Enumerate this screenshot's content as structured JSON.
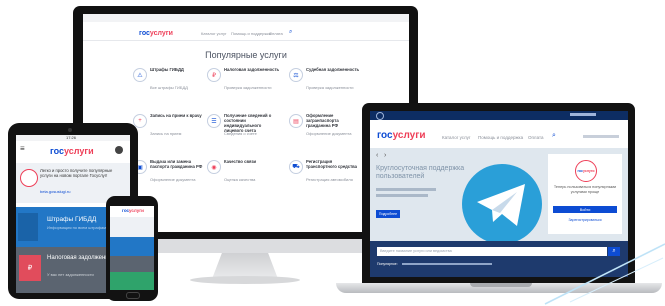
{
  "colors": {
    "brand_blue": "#0d4cd3",
    "brand_red": "#ee3f58",
    "tile_blue": "#2277c6",
    "tile_red": "#e14c5c",
    "hero_bg": "#dfe7ee"
  },
  "brand": {
    "gos": "гос",
    "uslugi": "услуги"
  },
  "monitor": {
    "nav": [
      "Каталог услуг",
      "Помощь и поддержка",
      "Оплата"
    ],
    "section_title": "Популярные услуги",
    "services": [
      {
        "icon": "traffic-fine-icon",
        "title": "Штрафы ГИБДД",
        "desc": "Все штрафы ГИБДД"
      },
      {
        "icon": "tax-icon",
        "title": "Налоговая задолженность",
        "desc": "Проверка задолженности"
      },
      {
        "icon": "court-icon",
        "title": "Судебная задолженность",
        "desc": "Проверка задолженности"
      },
      {
        "icon": "doctor-icon",
        "title": "Запись на прием к врачу",
        "desc": "Запись на прием"
      },
      {
        "icon": "pension-icon",
        "title": "Получение сведений о состоянии индивидуального лицевого счета",
        "desc": "Сведения о счете"
      },
      {
        "icon": "passport-icon",
        "title": "Оформление загранпаспорта гражданина РФ",
        "desc": "Оформление документа"
      },
      {
        "icon": "passport-change-icon",
        "title": "Выдача или замена паспорта гражданина РФ",
        "desc": "Оформление документа"
      },
      {
        "icon": "quality-icon",
        "title": "Качество связи",
        "desc": "Оценка качества"
      },
      {
        "icon": "car-icon",
        "title": "Регистрация транспортного средства",
        "desc": "Регистрация автомобиля"
      }
    ]
  },
  "laptop": {
    "nav": [
      "Каталог услуг",
      "Помощь и поддержка",
      "Оплата"
    ],
    "hero_title": "Круглосуточная поддержка пользователей",
    "hero_button": "Подробнее",
    "login_title": "Теперь пользоваться популярными услугами проще",
    "login_button": "Войти",
    "register_link": "Зарегистрироваться",
    "search_placeholder": "Введите название услуги или ведомства",
    "popular_prefix": "Популярное:"
  },
  "tablet": {
    "time": "17:26",
    "promo_text": "Легко и просто получите популярные услуги на новом портале Госуслуг!",
    "promo_link": "beta.gosuslugi.ru",
    "tile1_title": "Штрафы ГИБДД",
    "tile1_sub": "Информация по всем штрафам",
    "tile2_badge": "₽",
    "tile2_title": "Налоговая задолженность",
    "tile2_sub": "У вас нет задолженности"
  },
  "phone": {}
}
